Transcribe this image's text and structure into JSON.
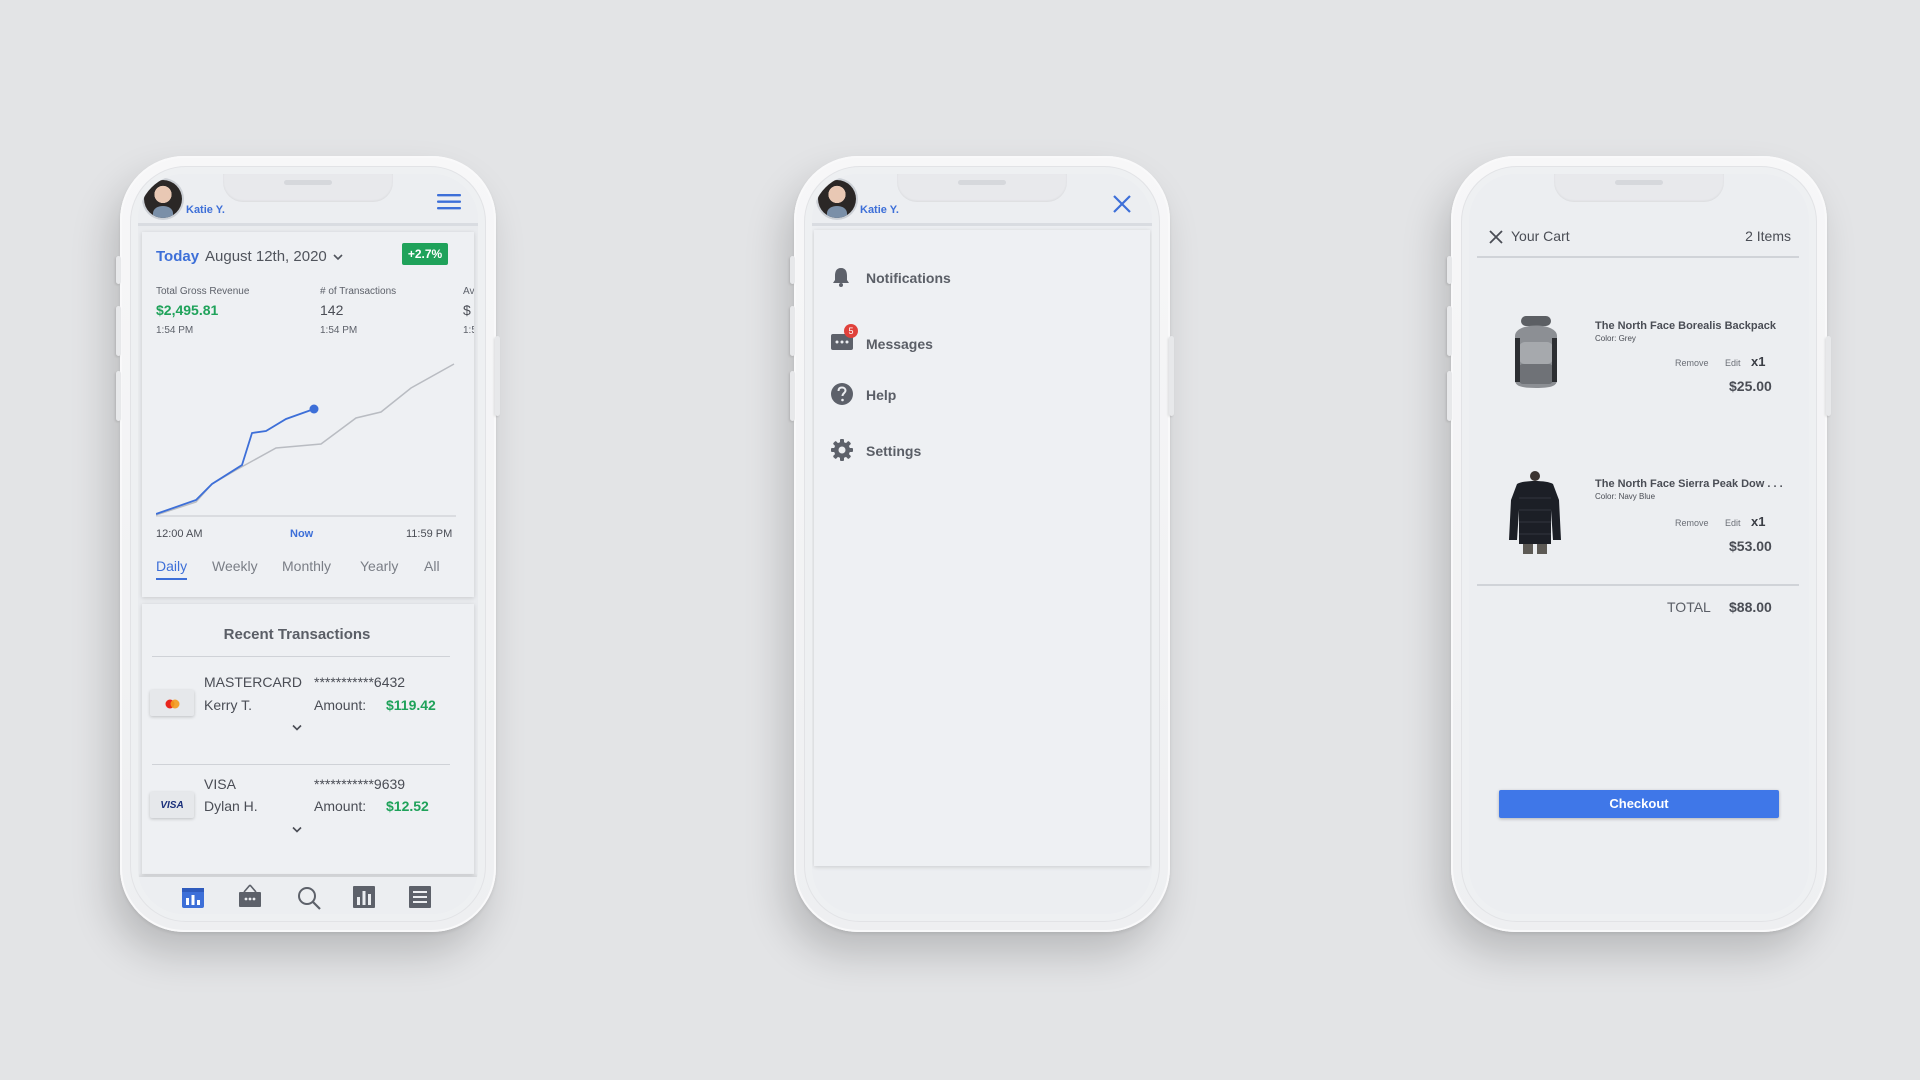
{
  "phone1": {
    "user": "Katie Y.",
    "header": {
      "today": "Today",
      "date": "August 12th, 2020",
      "change": "+2.7%"
    },
    "metrics": [
      {
        "label": "Total Gross Revenue",
        "value": "$2,495.81",
        "time": "1:54 PM"
      },
      {
        "label": "# of Transactions",
        "value": "142",
        "time": "1:54 PM"
      },
      {
        "label": "Av",
        "value": "$",
        "time": "1:5"
      }
    ],
    "axis": {
      "start": "12:00 AM",
      "now": "Now",
      "end": "11:59 PM"
    },
    "ranges": [
      "Daily",
      "Weekly",
      "Monthly",
      "Yearly",
      "All"
    ],
    "recent_title": "Recent Transactions",
    "transactions": [
      {
        "card": "MASTERCARD",
        "number": "***********6432",
        "name": "Kerry T.",
        "amount_label": "Amount:",
        "amount": "$119.42"
      },
      {
        "card": "VISA",
        "number": "***********9639",
        "name": "Dylan H.",
        "amount_label": "Amount:",
        "amount": "$12.52"
      }
    ],
    "visa_logo": "VISA",
    "colors": {
      "accent": "#3d6fd8",
      "positive": "#1fa25a"
    }
  },
  "phone2": {
    "user": "Katie Y.",
    "menu": [
      {
        "label": "Notifications",
        "icon": "bell-icon"
      },
      {
        "label": "Messages",
        "icon": "messages-icon",
        "badge": "5"
      },
      {
        "label": "Help",
        "icon": "help-icon"
      },
      {
        "label": "Settings",
        "icon": "gear-icon"
      }
    ]
  },
  "phone3": {
    "title": "Your Cart",
    "count": "2 Items",
    "items": [
      {
        "name": "The North Face Borealis Backpack",
        "color": "Color: Grey",
        "remove": "Remove",
        "edit": "Edit",
        "qty": "x1",
        "price": "$25.00"
      },
      {
        "name": "The North Face Sierra Peak Dow . . .",
        "color": "Color: Navy Blue",
        "remove": "Remove",
        "edit": "Edit",
        "qty": "x1",
        "price": "$53.00"
      }
    ],
    "total_label": "TOTAL",
    "total": "$88.00",
    "checkout": "Checkout"
  }
}
